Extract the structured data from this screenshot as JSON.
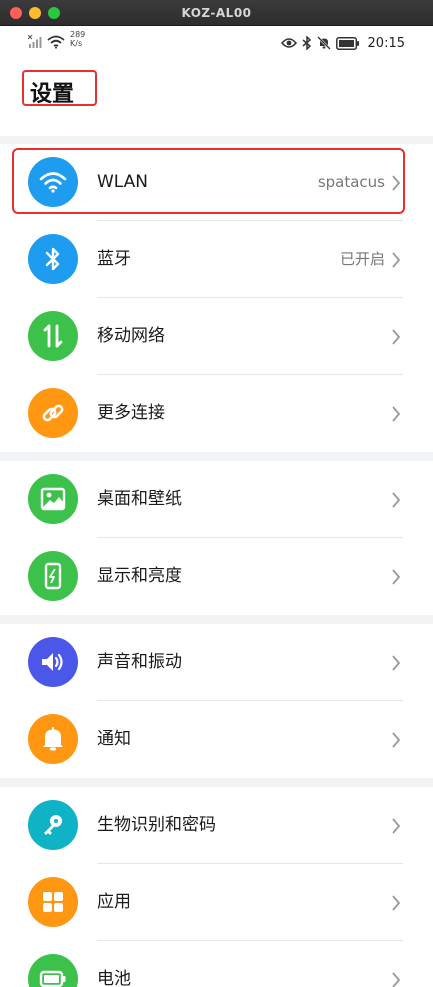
{
  "window": {
    "title": "KOZ-AL00"
  },
  "status_bar": {
    "net_speed_value": "289",
    "net_speed_unit": "K/s",
    "time": "20:15",
    "icons": [
      "signal-icon",
      "wifi-icon",
      "eye-icon",
      "bluetooth-icon",
      "mute-bell-icon",
      "battery-icon"
    ]
  },
  "header": {
    "title": "设置"
  },
  "groups": [
    {
      "items": [
        {
          "label": "WLAN",
          "value": "spatacus",
          "icon": "wifi-icon",
          "color": "#1e9cf0"
        },
        {
          "label": "蓝牙",
          "value": "已开启",
          "icon": "bluetooth-icon",
          "color": "#1e9cf0"
        },
        {
          "label": "移动网络",
          "value": "",
          "icon": "mobile-data-icon",
          "color": "#3cc24a"
        },
        {
          "label": "更多连接",
          "value": "",
          "icon": "link-icon",
          "color": "#ff9712"
        }
      ]
    },
    {
      "items": [
        {
          "label": "桌面和壁纸",
          "value": "",
          "icon": "wallpaper-icon",
          "color": "#3cc24a"
        },
        {
          "label": "显示和亮度",
          "value": "",
          "icon": "display-icon",
          "color": "#3cc24a"
        }
      ]
    },
    {
      "items": [
        {
          "label": "声音和振动",
          "value": "",
          "icon": "volume-icon",
          "color": "#4a57e8"
        },
        {
          "label": "通知",
          "value": "",
          "icon": "bell-icon",
          "color": "#ff9712"
        }
      ]
    },
    {
      "items": [
        {
          "label": "生物识别和密码",
          "value": "",
          "icon": "key-icon",
          "color": "#10b3c6"
        },
        {
          "label": "应用",
          "value": "",
          "icon": "apps-grid-icon",
          "color": "#ff9712"
        },
        {
          "label": "电池",
          "value": "",
          "icon": "battery-icon",
          "color": "#3cc24a"
        }
      ]
    }
  ]
}
